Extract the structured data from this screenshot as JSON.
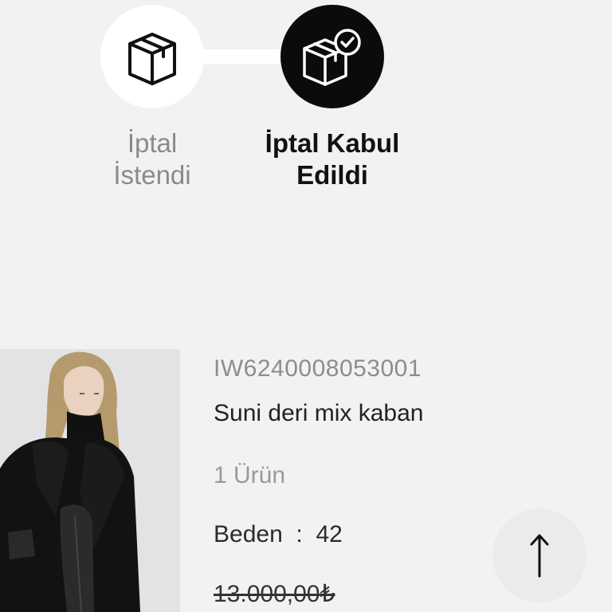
{
  "stepper": {
    "steps": [
      {
        "label_line1": "İptal",
        "label_line2": "İstendi",
        "state": "pending",
        "icon": "box-icon"
      },
      {
        "label_line1": "İptal Kabul",
        "label_line2": "Edildi",
        "state": "active",
        "icon": "box-check-icon"
      }
    ]
  },
  "product": {
    "sku": "IW6240008053001",
    "name": "Suni deri mix kaban",
    "quantity": "1 Ürün",
    "size_label": "Beden",
    "size_separator": ":",
    "size_value": "42",
    "old_price": "13.000,00₺"
  },
  "scroll_top": {
    "icon": "arrow-up-icon"
  },
  "colors": {
    "background": "#f2f2f2",
    "active_step": "#0b0b0b",
    "pending_step": "#ffffff",
    "muted_text": "#8a8a8a",
    "primary_text": "#111111"
  }
}
